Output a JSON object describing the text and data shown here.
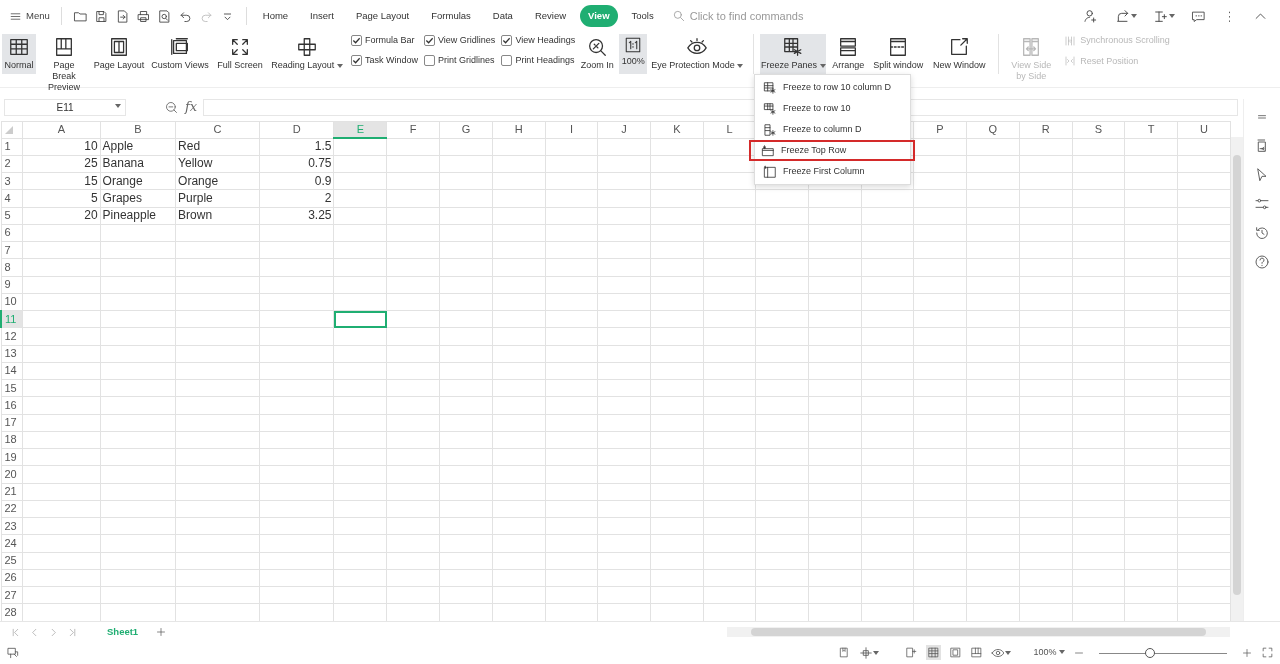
{
  "toolbar": {
    "menu_label": "Menu",
    "tabs": [
      {
        "label": "Home",
        "selected": false
      },
      {
        "label": "Insert",
        "selected": false
      },
      {
        "label": "Page Layout",
        "selected": false
      },
      {
        "label": "Formulas",
        "selected": false
      },
      {
        "label": "Data",
        "selected": false
      },
      {
        "label": "Review",
        "selected": false
      },
      {
        "label": "View",
        "selected": true
      },
      {
        "label": "Tools",
        "selected": false
      }
    ],
    "search": {
      "placeholder": "Click to find commands"
    }
  },
  "ribbon": [
    {
      "kind": "large",
      "label": "Normal",
      "selected": true,
      "disabled": false,
      "dropdown": false
    },
    {
      "kind": "large",
      "label": "Page Break Preview",
      "selected": false,
      "disabled": false,
      "dropdown": false
    },
    {
      "kind": "large",
      "label": "Page Layout",
      "selected": false,
      "disabled": false,
      "dropdown": false
    },
    {
      "kind": "large",
      "label": "Custom Views",
      "selected": false,
      "disabled": false,
      "dropdown": false
    },
    {
      "kind": "large",
      "label": "Full Screen",
      "selected": false,
      "disabled": false,
      "dropdown": false
    },
    {
      "kind": "large",
      "label": "Reading Layout",
      "selected": false,
      "disabled": false,
      "dropdown": true
    },
    {
      "kind": "checks",
      "items": [
        {
          "label": "Formula Bar",
          "checked": true
        },
        {
          "label": "Task Window",
          "checked": true
        }
      ]
    },
    {
      "kind": "checks",
      "items": [
        {
          "label": "View Gridlines",
          "checked": true
        },
        {
          "label": "Print Gridlines",
          "checked": false
        }
      ]
    },
    {
      "kind": "checks",
      "items": [
        {
          "label": "View Headings",
          "checked": true
        },
        {
          "label": "Print Headings",
          "checked": false
        }
      ]
    },
    {
      "kind": "large",
      "label": "Zoom In",
      "selected": false,
      "disabled": false,
      "dropdown": false
    },
    {
      "kind": "large",
      "label": "100%",
      "selected": true,
      "disabled": false,
      "dropdown": false
    },
    {
      "kind": "large",
      "label": "Eye Protection Mode",
      "selected": false,
      "disabled": false,
      "dropdown": true
    },
    {
      "kind": "large",
      "label": "Freeze Panes",
      "selected": true,
      "disabled": false,
      "dropdown": true
    },
    {
      "kind": "large",
      "label": "Arrange",
      "selected": false,
      "disabled": false,
      "dropdown": false
    },
    {
      "kind": "large",
      "label": "Split window",
      "selected": false,
      "disabled": false,
      "dropdown": false
    },
    {
      "kind": "large",
      "label": "New Window",
      "selected": false,
      "disabled": false,
      "dropdown": false
    },
    {
      "kind": "large",
      "label": "View Side by Side",
      "selected": false,
      "disabled": true,
      "dropdown": false
    },
    {
      "kind": "smalls",
      "items": [
        {
          "label": "Synchronous Scrolling",
          "disabled": true
        },
        {
          "label": "Reset Position",
          "disabled": true
        }
      ]
    }
  ],
  "freeze_menu": [
    {
      "label": "Freeze to row 10 column D",
      "highlighted": false
    },
    {
      "label": "Freeze to row 10",
      "highlighted": false
    },
    {
      "label": "Freeze to column D",
      "highlighted": false
    },
    {
      "label": "Freeze Top Row",
      "highlighted": true
    },
    {
      "label": "Freeze First Column",
      "highlighted": false
    }
  ],
  "name_box": {
    "value": "E11"
  },
  "formula_bar": {
    "function_label": "fx"
  },
  "sheet": {
    "columns": [
      {
        "label": "A",
        "selected": false
      },
      {
        "label": "B",
        "selected": false
      },
      {
        "label": "C",
        "selected": false
      },
      {
        "label": "D",
        "selected": false
      },
      {
        "label": "E",
        "selected": true
      },
      {
        "label": "F",
        "selected": false
      },
      {
        "label": "G",
        "selected": false
      },
      {
        "label": "H",
        "selected": false
      },
      {
        "label": "I",
        "selected": false
      },
      {
        "label": "J",
        "selected": false
      },
      {
        "label": "K",
        "selected": false
      },
      {
        "label": "L",
        "selected": false
      },
      {},
      {},
      {},
      {
        "label": "P",
        "selected": false
      },
      {
        "label": "Q",
        "selected": false
      },
      {
        "label": "R",
        "selected": false
      },
      {
        "label": "S",
        "selected": false
      },
      {
        "label": "T",
        "selected": false
      },
      {
        "label": "U",
        "selected": false
      }
    ],
    "rows": [
      {
        "label": "1",
        "selected": false,
        "cells": [
          "10",
          "Apple",
          "Red",
          "1.5"
        ]
      },
      {
        "label": "2",
        "selected": false,
        "cells": [
          "25",
          "Banana",
          "Yellow",
          "0.75"
        ]
      },
      {
        "label": "3",
        "selected": false,
        "cells": [
          "15",
          "Orange",
          "Orange",
          "0.9"
        ]
      },
      {
        "label": "4",
        "selected": false,
        "cells": [
          "5",
          "Grapes",
          "Purple",
          "2"
        ]
      },
      {
        "label": "5",
        "selected": false,
        "cells": [
          "20",
          "Pineapple",
          "Brown",
          "3.25"
        ]
      },
      {
        "label": "6",
        "selected": false
      },
      {
        "label": "7",
        "selected": false
      },
      {
        "label": "8",
        "selected": false
      },
      {
        "label": "9",
        "selected": false
      },
      {
        "label": "10",
        "selected": false
      },
      {
        "label": "11",
        "selected": true
      },
      {
        "label": "12",
        "selected": false
      },
      {
        "label": "13",
        "selected": false
      },
      {
        "label": "14",
        "selected": false
      },
      {
        "label": "15",
        "selected": false
      },
      {
        "label": "16",
        "selected": false
      },
      {
        "label": "17",
        "selected": false
      },
      {
        "label": "18",
        "selected": false
      },
      {
        "label": "19",
        "selected": false
      },
      {
        "label": "20",
        "selected": false
      },
      {
        "label": "21",
        "selected": false
      },
      {
        "label": "22",
        "selected": false
      },
      {
        "label": "23",
        "selected": false
      },
      {
        "label": "24",
        "selected": false
      },
      {
        "label": "25",
        "selected": false
      },
      {
        "label": "26",
        "selected": false
      },
      {
        "label": "27",
        "selected": false
      },
      {
        "label": "28",
        "selected": false
      }
    ]
  },
  "sheet_tabs": [
    {
      "label": "Sheet1",
      "selected": true
    }
  ],
  "status_bar": {
    "zoom": "100%",
    "zoom_slider": {
      "level": 0.4
    }
  }
}
